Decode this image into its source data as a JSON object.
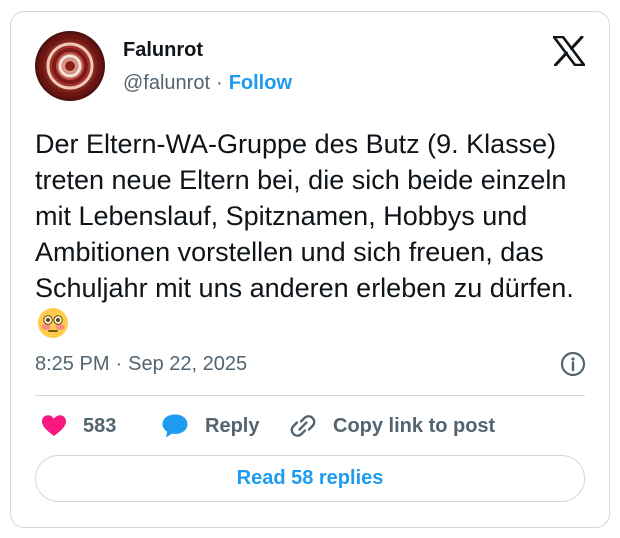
{
  "tweet": {
    "author_name": "Falunrot",
    "handle": "@falunrot",
    "separator": "·",
    "follow_label": "Follow",
    "text": "Der Eltern-WA-Gruppe des Butz (9. Klasse) treten neue Eltern bei, die sich beide einzeln mit Lebenslauf, Spitznamen, Hobbys und Ambitionen vorstellen und sich freuen, das Schuljahr mit uns anderen erleben zu dürfen.",
    "emoji": "flushed-face-emoji",
    "time": "8:25 PM",
    "date": "Sep 22, 2025"
  },
  "actions": {
    "like_count": "583",
    "reply_label": "Reply",
    "copy_link_label": "Copy link to post"
  },
  "read_replies_label": "Read 58 replies",
  "icons": {
    "logo": "x-logo-icon",
    "like": "heart-icon",
    "reply": "speech-bubble-icon",
    "copy": "link-icon",
    "info": "info-icon"
  },
  "colors": {
    "accent": "#1d9bf0",
    "like": "#f91880",
    "secondary_text": "#536471",
    "primary_text": "#0f1419",
    "border": "#cfd9de"
  }
}
